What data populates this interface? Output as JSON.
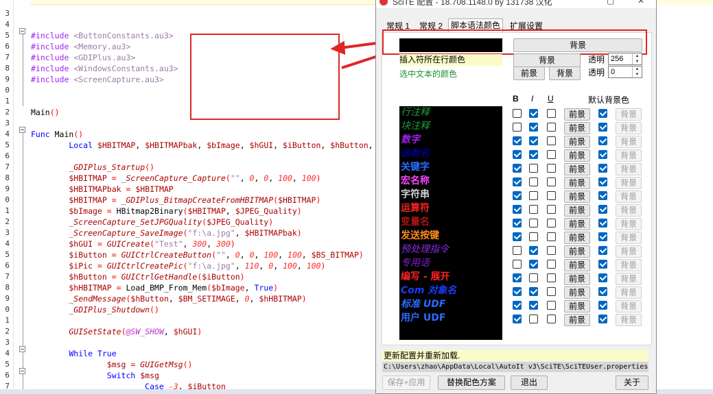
{
  "editor": {
    "line_numbers": [
      "3",
      "4",
      "5",
      "6",
      "7",
      "8",
      "9",
      "0",
      "1",
      "2",
      "3",
      "4",
      "5",
      "6",
      "7",
      "8",
      "9",
      "0",
      "1",
      "2",
      "3",
      "4",
      "5",
      "6",
      "7",
      "8",
      "9",
      "0",
      "1",
      "2",
      "3",
      "4",
      "5",
      "6",
      "7"
    ],
    "lines": [
      [],
      [],
      [
        {
          "t": "#include ",
          "c": "c-pre"
        },
        {
          "t": "<ButtonConstants.au3>",
          "c": "c-str"
        }
      ],
      [
        {
          "t": "#include ",
          "c": "c-pre"
        },
        {
          "t": "<Memory.au3>",
          "c": "c-str"
        }
      ],
      [
        {
          "t": "#include ",
          "c": "c-pre"
        },
        {
          "t": "<GDIPlus.au3>",
          "c": "c-str"
        }
      ],
      [
        {
          "t": "#include ",
          "c": "c-pre"
        },
        {
          "t": "<WindowsConstants.au3>",
          "c": "c-str"
        }
      ],
      [
        {
          "t": "#include ",
          "c": "c-pre"
        },
        {
          "t": "<ScreenCapture.au3>",
          "c": "c-str"
        }
      ],
      [],
      [],
      [
        {
          "t": "Main",
          "c": "c-def"
        },
        {
          "t": "()",
          "c": "c-op"
        }
      ],
      [],
      [
        {
          "t": "Func ",
          "c": "c-kw"
        },
        {
          "t": "Main",
          "c": "c-def"
        },
        {
          "t": "()",
          "c": "c-op"
        }
      ],
      [
        {
          "t": "        Local ",
          "c": "c-kw"
        },
        {
          "t": "$HBITMAP",
          "c": "c-var"
        },
        {
          "t": ", ",
          "c": "c-def"
        },
        {
          "t": "$HBITMAPbak",
          "c": "c-var"
        },
        {
          "t": ", ",
          "c": "c-def"
        },
        {
          "t": "$bImage",
          "c": "c-var"
        },
        {
          "t": ", ",
          "c": "c-def"
        },
        {
          "t": "$hGUI",
          "c": "c-var"
        },
        {
          "t": ", ",
          "c": "c-def"
        },
        {
          "t": "$iButton",
          "c": "c-var"
        },
        {
          "t": ", ",
          "c": "c-def"
        },
        {
          "t": "$hButton",
          "c": "c-var"
        },
        {
          "t": ",",
          "c": "c-def"
        }
      ],
      [],
      [
        {
          "t": "        _GDIPlus_Startup",
          "c": "c-func"
        },
        {
          "t": "()",
          "c": "c-op"
        }
      ],
      [
        {
          "t": "        $HBITMAP",
          "c": "c-var"
        },
        {
          "t": " = ",
          "c": "c-op"
        },
        {
          "t": "_ScreenCapture_Capture",
          "c": "c-func"
        },
        {
          "t": "(",
          "c": "c-op"
        },
        {
          "t": "\"\"",
          "c": "c-str"
        },
        {
          "t": ", ",
          "c": "c-def"
        },
        {
          "t": "0",
          "c": "c-num"
        },
        {
          "t": ", ",
          "c": "c-def"
        },
        {
          "t": "0",
          "c": "c-num"
        },
        {
          "t": ", ",
          "c": "c-def"
        },
        {
          "t": "100",
          "c": "c-num"
        },
        {
          "t": ", ",
          "c": "c-def"
        },
        {
          "t": "100",
          "c": "c-num"
        },
        {
          "t": ")",
          "c": "c-op"
        }
      ],
      [
        {
          "t": "        $HBITMAPbak",
          "c": "c-var"
        },
        {
          "t": " = ",
          "c": "c-op"
        },
        {
          "t": "$HBITMAP",
          "c": "c-var"
        }
      ],
      [
        {
          "t": "        $HBITMAP",
          "c": "c-var"
        },
        {
          "t": " = ",
          "c": "c-op"
        },
        {
          "t": "_GDIPlus_BitmapCreateFromHBITMAP",
          "c": "c-func"
        },
        {
          "t": "(",
          "c": "c-op"
        },
        {
          "t": "$HBITMAP",
          "c": "c-var"
        },
        {
          "t": ")",
          "c": "c-op"
        }
      ],
      [
        {
          "t": "        $bImage",
          "c": "c-var"
        },
        {
          "t": " = ",
          "c": "c-op"
        },
        {
          "t": "HBitmap2Binary",
          "c": "c-def"
        },
        {
          "t": "(",
          "c": "c-op"
        },
        {
          "t": "$HBITMAP",
          "c": "c-var"
        },
        {
          "t": ", ",
          "c": "c-def"
        },
        {
          "t": "$JPEG_Quality",
          "c": "c-var"
        },
        {
          "t": ")",
          "c": "c-op"
        }
      ],
      [
        {
          "t": "        _ScreenCapture_SetJPGQuality",
          "c": "c-func"
        },
        {
          "t": "(",
          "c": "c-op"
        },
        {
          "t": "$JPEG_Quality",
          "c": "c-var"
        },
        {
          "t": ")",
          "c": "c-op"
        }
      ],
      [
        {
          "t": "        _ScreenCapture_SaveImage",
          "c": "c-func"
        },
        {
          "t": "(",
          "c": "c-op"
        },
        {
          "t": "\"f:\\a.jpg\"",
          "c": "c-str"
        },
        {
          "t": ", ",
          "c": "c-def"
        },
        {
          "t": "$HBITMAPbak",
          "c": "c-var"
        },
        {
          "t": ")",
          "c": "c-op"
        }
      ],
      [
        {
          "t": "        $hGUI",
          "c": "c-var"
        },
        {
          "t": " = ",
          "c": "c-op"
        },
        {
          "t": "GUICreate",
          "c": "c-func"
        },
        {
          "t": "(",
          "c": "c-op"
        },
        {
          "t": "\"Test\"",
          "c": "c-str"
        },
        {
          "t": ", ",
          "c": "c-def"
        },
        {
          "t": "300",
          "c": "c-num"
        },
        {
          "t": ", ",
          "c": "c-def"
        },
        {
          "t": "300",
          "c": "c-num"
        },
        {
          "t": ")",
          "c": "c-op"
        }
      ],
      [
        {
          "t": "        $iButton",
          "c": "c-var"
        },
        {
          "t": " = ",
          "c": "c-op"
        },
        {
          "t": "GUICtrlCreateButton",
          "c": "c-func"
        },
        {
          "t": "(",
          "c": "c-op"
        },
        {
          "t": "\"\"",
          "c": "c-str"
        },
        {
          "t": ", ",
          "c": "c-def"
        },
        {
          "t": "0",
          "c": "c-num"
        },
        {
          "t": ", ",
          "c": "c-def"
        },
        {
          "t": "0",
          "c": "c-num"
        },
        {
          "t": ", ",
          "c": "c-def"
        },
        {
          "t": "100",
          "c": "c-num"
        },
        {
          "t": ", ",
          "c": "c-def"
        },
        {
          "t": "100",
          "c": "c-num"
        },
        {
          "t": ", ",
          "c": "c-def"
        },
        {
          "t": "$BS_BITMAP",
          "c": "c-var"
        },
        {
          "t": ")",
          "c": "c-op"
        }
      ],
      [
        {
          "t": "        $iPic",
          "c": "c-var"
        },
        {
          "t": " = ",
          "c": "c-op"
        },
        {
          "t": "GUICtrlCreatePic",
          "c": "c-func"
        },
        {
          "t": "(",
          "c": "c-op"
        },
        {
          "t": "\"f:\\a.jpg\"",
          "c": "c-str"
        },
        {
          "t": ", ",
          "c": "c-def"
        },
        {
          "t": "110",
          "c": "c-num"
        },
        {
          "t": ", ",
          "c": "c-def"
        },
        {
          "t": "0",
          "c": "c-num"
        },
        {
          "t": ", ",
          "c": "c-def"
        },
        {
          "t": "100",
          "c": "c-num"
        },
        {
          "t": ", ",
          "c": "c-def"
        },
        {
          "t": "100",
          "c": "c-num"
        },
        {
          "t": ")",
          "c": "c-op"
        }
      ],
      [
        {
          "t": "        $hButton",
          "c": "c-var"
        },
        {
          "t": " = ",
          "c": "c-op"
        },
        {
          "t": "GUICtrlGetHandle",
          "c": "c-func"
        },
        {
          "t": "(",
          "c": "c-op"
        },
        {
          "t": "$iButton",
          "c": "c-var"
        },
        {
          "t": ")",
          "c": "c-op"
        }
      ],
      [
        {
          "t": "        $hHBITMAP",
          "c": "c-var"
        },
        {
          "t": " = ",
          "c": "c-op"
        },
        {
          "t": "Load_BMP_From_Mem",
          "c": "c-def"
        },
        {
          "t": "(",
          "c": "c-op"
        },
        {
          "t": "$bImage",
          "c": "c-var"
        },
        {
          "t": ", ",
          "c": "c-def"
        },
        {
          "t": "True",
          "c": "c-kw"
        },
        {
          "t": ")",
          "c": "c-op"
        }
      ],
      [
        {
          "t": "        _SendMessage",
          "c": "c-func"
        },
        {
          "t": "(",
          "c": "c-op"
        },
        {
          "t": "$hButton",
          "c": "c-var"
        },
        {
          "t": ", ",
          "c": "c-def"
        },
        {
          "t": "$BM_SETIMAGE",
          "c": "c-var"
        },
        {
          "t": ", ",
          "c": "c-def"
        },
        {
          "t": "0",
          "c": "c-num"
        },
        {
          "t": ", ",
          "c": "c-def"
        },
        {
          "t": "$hHBITMAP",
          "c": "c-var"
        },
        {
          "t": ")",
          "c": "c-op"
        }
      ],
      [
        {
          "t": "        _GDIPlus_Shutdown",
          "c": "c-func"
        },
        {
          "t": "()",
          "c": "c-op"
        }
      ],
      [],
      [
        {
          "t": "        GUISetState",
          "c": "c-func"
        },
        {
          "t": "(",
          "c": "c-op"
        },
        {
          "t": "@SW_SHOW",
          "c": "c-mac"
        },
        {
          "t": ", ",
          "c": "c-def"
        },
        {
          "t": "$hGUI",
          "c": "c-var"
        },
        {
          "t": ")",
          "c": "c-op"
        }
      ],
      [],
      [
        {
          "t": "        While ",
          "c": "c-kw"
        },
        {
          "t": "True",
          "c": "c-kw"
        }
      ],
      [
        {
          "t": "                $msg",
          "c": "c-var"
        },
        {
          "t": " = ",
          "c": "c-op"
        },
        {
          "t": "GUIGetMsg",
          "c": "c-func"
        },
        {
          "t": "()",
          "c": "c-op"
        }
      ],
      [
        {
          "t": "                Switch ",
          "c": "c-kw"
        },
        {
          "t": "$msg",
          "c": "c-var"
        }
      ],
      [
        {
          "t": "                        Case ",
          "c": "c-kw"
        },
        {
          "t": "-3",
          "c": "c-num"
        },
        {
          "t": ", ",
          "c": "c-def"
        },
        {
          "t": "$iButton",
          "c": "c-var"
        }
      ]
    ]
  },
  "dialog": {
    "title": "SciTE 配置 - 18.708.1148.0  by 131738 汉化",
    "tabs": [
      "常规 1",
      "常规 2",
      "脚本语法颜色",
      "扩展设置"
    ],
    "active_tab": 2,
    "bg_button": "背景",
    "caret_line_label": "插入符所在行颜色",
    "caret_bg_button": "背景",
    "opacity_label": "透明",
    "opacity_value": "256",
    "selection_label": "选中文本的颜色",
    "sel_fore_button": "前景",
    "sel_back_button": "背景",
    "opacity2_label": "透明",
    "opacity2_value": "0",
    "col_b": "B",
    "col_i": "I",
    "col_u": "U",
    "default_bg_header": "默认背景色",
    "fore_label": "前景",
    "back_label": "背景",
    "styles": [
      {
        "name": "行注释",
        "color": "#1e9a3a",
        "italic": true,
        "bold": false,
        "b": false,
        "i": true,
        "u": false,
        "def": true
      },
      {
        "name": "块注释",
        "color": "#1e9a3a",
        "italic": true,
        "bold": false,
        "b": false,
        "i": true,
        "u": false,
        "def": true
      },
      {
        "name": "数字",
        "color": "#a020f0",
        "italic": true,
        "bold": true,
        "b": true,
        "i": true,
        "u": false,
        "def": true
      },
      {
        "name": "函数名",
        "color": "#0000c8",
        "italic": true,
        "bold": false,
        "b": true,
        "i": true,
        "u": false,
        "def": true
      },
      {
        "name": "关键字",
        "color": "#2a6cff",
        "italic": false,
        "bold": true,
        "b": true,
        "i": false,
        "u": false,
        "def": true
      },
      {
        "name": "宏名称",
        "color": "#ff44ff",
        "italic": false,
        "bold": true,
        "b": true,
        "i": false,
        "u": false,
        "def": true
      },
      {
        "name": "字符串",
        "color": "#cfcfcf",
        "italic": false,
        "bold": true,
        "b": true,
        "i": false,
        "u": false,
        "def": true
      },
      {
        "name": "运算符",
        "color": "#ff2222",
        "italic": false,
        "bold": true,
        "b": true,
        "i": false,
        "u": false,
        "def": true
      },
      {
        "name": "变量名",
        "color": "#b01212",
        "italic": false,
        "bold": true,
        "b": true,
        "i": false,
        "u": false,
        "def": true
      },
      {
        "name": "发送按键",
        "color": "#ff8a1a",
        "italic": false,
        "bold": true,
        "b": true,
        "i": false,
        "u": false,
        "def": true
      },
      {
        "name": "预处理指令",
        "color": "#8a2be2",
        "italic": true,
        "bold": false,
        "b": false,
        "i": true,
        "u": false,
        "def": true
      },
      {
        "name": "专用语",
        "color": "#7a1fd0",
        "italic": true,
        "bold": false,
        "b": false,
        "i": true,
        "u": false,
        "def": true
      },
      {
        "name": "编写 - 展开",
        "color": "#ff2222",
        "italic": false,
        "bold": true,
        "b": true,
        "i": false,
        "u": false,
        "def": true
      },
      {
        "name": "Com 对象名",
        "color": "#1a3cff",
        "italic": true,
        "bold": true,
        "b": true,
        "i": true,
        "u": false,
        "def": true
      },
      {
        "name": "标准 UDF",
        "color": "#2a6cff",
        "italic": true,
        "bold": true,
        "b": true,
        "i": true,
        "u": false,
        "def": true
      },
      {
        "name": "用户 UDF",
        "color": "#2a6cff",
        "italic": false,
        "bold": true,
        "b": true,
        "i": false,
        "u": false,
        "def": true
      }
    ],
    "status_message": "更新配置并重新加载.",
    "config_path": "C:\\Users\\zhao\\AppData\\Local\\AutoIt v3\\SciTE\\SciTEUser.properties",
    "buttons": {
      "save_apply": "保存+应用",
      "replace_scheme": "替换配色方案",
      "exit": "退出",
      "about": "关于"
    }
  }
}
